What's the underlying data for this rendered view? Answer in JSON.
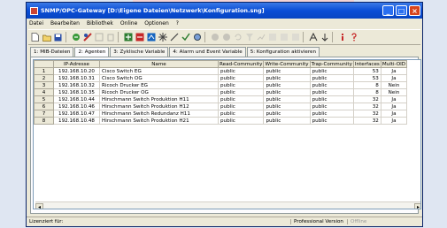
{
  "window": {
    "title": "SNMP/OPC-Gateway [D:\\Eigene Dateien\\Netzwerk\\Konfiguration.sng]",
    "minimize": "_",
    "maximize": "□",
    "close": "×"
  },
  "menu": [
    "Datei",
    "Bearbeiten",
    "Bibliothek",
    "Online",
    "Optionen",
    "?"
  ],
  "tabs": [
    "1: MIB-Dateien",
    "2: Agenten",
    "3: Zyklische Variable",
    "4: Alarm und Event Variable",
    "5: Konfiguration aktivieren"
  ],
  "active_tab": 1,
  "table": {
    "columns": [
      "",
      "IP-Adresse",
      "Name",
      "Read-Community",
      "Write-Community",
      "Trap-Community",
      "Interfaces",
      "Multi-OID"
    ],
    "rows": [
      [
        "1",
        "192.168.10.20",
        "Cisco Switch EG",
        "public",
        "public",
        "public",
        "53",
        "Ja"
      ],
      [
        "2",
        "192.168.10.31",
        "Cisco Switch OG",
        "public",
        "public",
        "public",
        "53",
        "Ja"
      ],
      [
        "3",
        "192.168.10.32",
        "Ricoch Drucker EG",
        "public",
        "public",
        "public",
        "8",
        "Nein"
      ],
      [
        "4",
        "192.168.10.35",
        "Ricoch Drucker OG",
        "public",
        "public",
        "public",
        "8",
        "Nein"
      ],
      [
        "5",
        "192.168.10.44",
        "Hirschmann Switch Produktion H11",
        "public",
        "public",
        "public",
        "32",
        "Ja"
      ],
      [
        "6",
        "192.168.10.46",
        "Hirschmann Switch Produktion H12",
        "public",
        "public",
        "public",
        "32",
        "Ja"
      ],
      [
        "7",
        "192.168.10.47",
        "Hirschmann Switch Redundanz H11",
        "public",
        "public",
        "public",
        "32",
        "Ja"
      ],
      [
        "8",
        "192.168.10.48",
        "Hirschmann Switch Produktion H21",
        "public",
        "public",
        "public",
        "32",
        "Ja"
      ]
    ]
  },
  "scroll": {
    "left": "◂",
    "right": "▸"
  },
  "status": {
    "license": "Lizenziert für:",
    "edition": "Professional Version",
    "mode": "Offline"
  }
}
